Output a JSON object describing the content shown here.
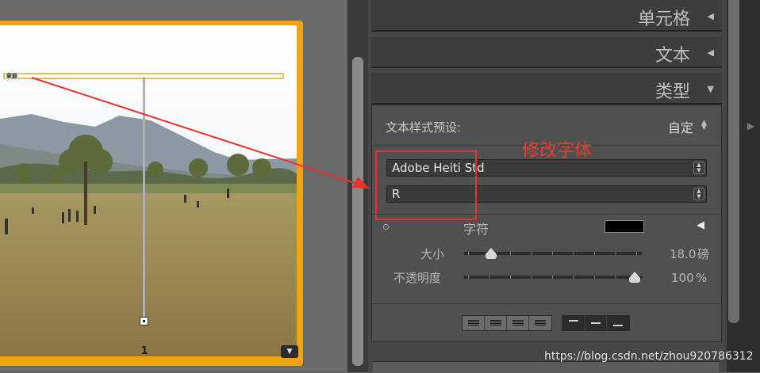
{
  "canvas": {
    "textbox_label": "家庭",
    "page_number": "1",
    "page_menu_icon": "chevron-down-icon"
  },
  "panel": {
    "sections": [
      {
        "title": "单元格",
        "expanded": false
      },
      {
        "title": "文本",
        "expanded": false
      },
      {
        "title": "类型",
        "expanded": true
      }
    ],
    "type": {
      "preset_label": "文本样式预设:",
      "preset_value": "自定",
      "font_family": "Adobe Heiti Std",
      "font_style": "R",
      "glyph_label": "字符",
      "glyph_color": "#000000",
      "size_label": "大小",
      "size_value": "18.0",
      "size_unit": "磅",
      "size_level": 0.14,
      "opacity_label": "不透明度",
      "opacity_value": "100",
      "opacity_unit": "%",
      "opacity_level": 1.0,
      "alignment": [
        "align-left",
        "align-center",
        "align-right",
        "justify",
        "align-top",
        "align-middle",
        "align-bottom"
      ]
    }
  },
  "annotation": {
    "label": "修改字体",
    "color": "#f03a30"
  },
  "watermark": "https://blog.csdn.net/zhou920786312",
  "colors": {
    "accent": "#f2a30f",
    "panel_bg": "#474747",
    "annotation": "#e8322c"
  }
}
